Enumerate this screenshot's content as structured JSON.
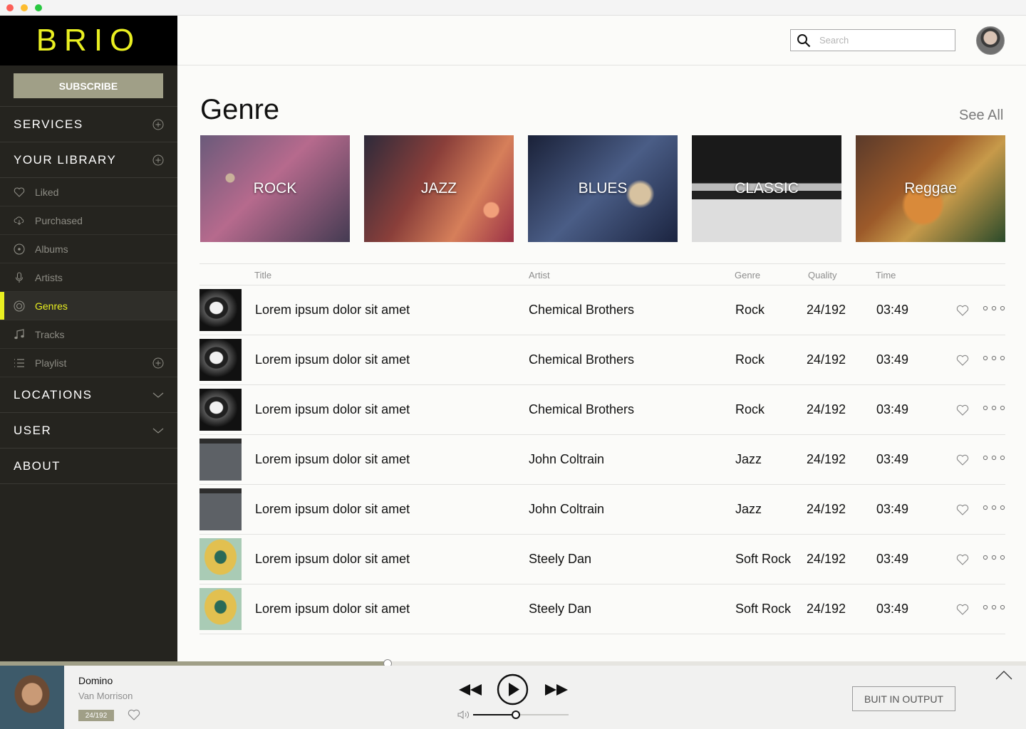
{
  "app": {
    "brand": "BRIO"
  },
  "sidebar": {
    "subscribe_label": "SUBSCRIBE",
    "services_label": "SERVICES",
    "library_label": "YOUR LIBRARY",
    "library_items": [
      {
        "label": "Liked",
        "icon": "heart-icon"
      },
      {
        "label": "Purchased",
        "icon": "cloud-download-icon"
      },
      {
        "label": "Albums",
        "icon": "disc-icon"
      },
      {
        "label": "Artists",
        "icon": "microphone-icon"
      },
      {
        "label": "Genres",
        "icon": "genres-icon"
      },
      {
        "label": "Tracks",
        "icon": "music-note-icon"
      },
      {
        "label": "Playlist",
        "icon": "list-icon"
      }
    ],
    "locations_label": "LOCATIONS",
    "user_label": "USER",
    "about_label": "ABOUT",
    "active_item": "Genres",
    "accent_color": "#e9ef21"
  },
  "header": {
    "search_placeholder": "Search"
  },
  "main": {
    "genre_title": "Genre",
    "see_all_label": "See All",
    "genres": [
      "ROCK",
      "JAZZ",
      "BLUES",
      "CLASSIC",
      "Reggae"
    ],
    "table_headers": {
      "title": "Title",
      "artist": "Artist",
      "genre": "Genre",
      "quality": "Quality",
      "time": "Time"
    },
    "tracks": [
      {
        "title": "Lorem ipsum dolor sit amet",
        "artist": "Chemical Brothers",
        "genre": "Rock",
        "quality": "24/192",
        "time": "03:49"
      },
      {
        "title": "Lorem ipsum dolor sit amet",
        "artist": "Chemical Brothers",
        "genre": "Rock",
        "quality": "24/192",
        "time": "03:49"
      },
      {
        "title": "Lorem ipsum dolor sit amet",
        "artist": "Chemical Brothers",
        "genre": "Rock",
        "quality": "24/192",
        "time": "03:49"
      },
      {
        "title": "Lorem ipsum dolor sit amet",
        "artist": "John Coltrain",
        "genre": "Jazz",
        "quality": "24/192",
        "time": "03:49"
      },
      {
        "title": "Lorem ipsum dolor sit amet",
        "artist": "John Coltrain",
        "genre": "Jazz",
        "quality": "24/192",
        "time": "03:49"
      },
      {
        "title": "Lorem ipsum dolor sit amet",
        "artist": "Steely Dan",
        "genre": "Soft Rock",
        "quality": "24/192",
        "time": "03:49"
      },
      {
        "title": "Lorem ipsum dolor sit amet",
        "artist": "Steely Dan",
        "genre": "Soft Rock",
        "quality": "24/192",
        "time": "03:49"
      }
    ]
  },
  "player": {
    "title": "Domino",
    "artist": "Van Morrison",
    "quality": "24/192",
    "progress": 0.378,
    "volume": 0.45,
    "output_label": "BUIT IN OUTPUT"
  }
}
